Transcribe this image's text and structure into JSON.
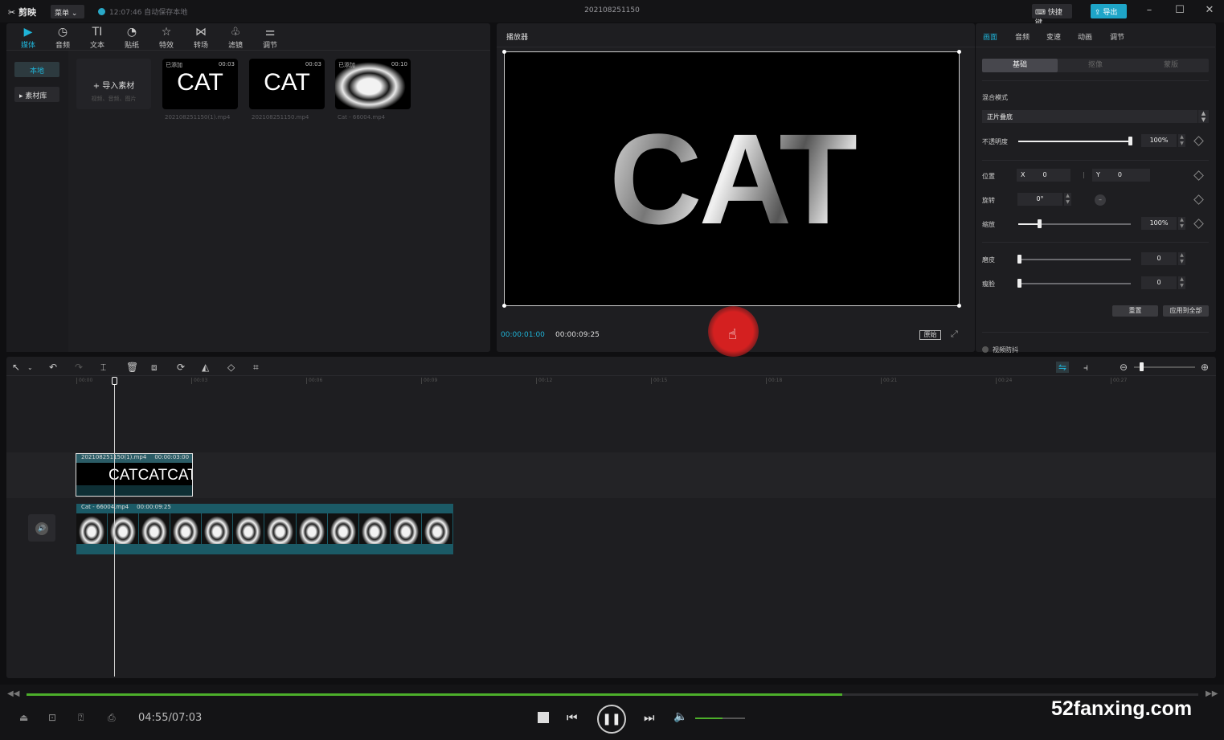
{
  "titlebar": {
    "app_name": "剪映",
    "menu_label": "菜单 ⌄",
    "save_status": "12:07:46 自动保存本地",
    "project_title": "202108251150",
    "shortcut_label": "⌨ 快捷键",
    "export_label": "⇪ 导出"
  },
  "media_toolbar": [
    {
      "icon": "▶",
      "label": "媒体"
    },
    {
      "icon": "◷",
      "label": "音频"
    },
    {
      "icon": "TI",
      "label": "文本"
    },
    {
      "icon": "◔",
      "label": "贴纸"
    },
    {
      "icon": "☆",
      "label": "特效"
    },
    {
      "icon": "⋈",
      "label": "转场"
    },
    {
      "icon": "♧",
      "label": "滤镜"
    },
    {
      "icon": "⚌",
      "label": "调节"
    }
  ],
  "left_nav": {
    "local": "本地",
    "library": "▸ 素材库"
  },
  "import": {
    "label": "+ 导入素材",
    "hint": "视频、音频、图片"
  },
  "media_items": [
    {
      "tag": "已添加",
      "duration": "00:03",
      "text": "CAT",
      "name": "202108251150(1).mp4"
    },
    {
      "tag": "",
      "duration": "00:03",
      "text": "CAT",
      "name": "202108251150.mp4"
    },
    {
      "tag": "已添加",
      "duration": "00:10",
      "text": "",
      "name": "Cat - 66004.mp4"
    }
  ],
  "player": {
    "title": "播放器",
    "big_text": "CAT",
    "current_time": "00:00:01:00",
    "total_time": "00:00:09:25",
    "ratio_label": "原始"
  },
  "properties": {
    "tabs": [
      "画面",
      "音频",
      "变速",
      "动画",
      "调节"
    ],
    "segments": [
      "基础",
      "抠像",
      "蒙版"
    ],
    "blend_label": "混合模式",
    "blend_value": "正片叠底",
    "opacity_label": "不透明度",
    "opacity_value": "100%",
    "opacity_level": 1.0,
    "position_label": "位置",
    "x_label": "X",
    "x_value": "0",
    "y_label": "Y",
    "y_value": "0",
    "rotate_label": "旋转",
    "rotate_value": "0°",
    "scale_label": "缩放",
    "scale_value": "100%",
    "smooth_label": "磨皮",
    "smooth_value": "0",
    "slim_label": "瘦脸",
    "slim_value": "0",
    "reset_label": "重置",
    "apply_all_label": "应用到全部",
    "stabilize_label": "视频防抖"
  },
  "timeline": {
    "ticks": [
      "00:00",
      "00:03",
      "00:06",
      "00:09",
      "00:12",
      "00:15",
      "00:18",
      "00:21",
      "00:24",
      "00:27"
    ],
    "text_clip": {
      "name": "202108251150(1).mp4",
      "duration": "00:00:03:00",
      "content": "CATCATCAT"
    },
    "video_clip": {
      "name": "Cat - 66004.mp4",
      "duration": "00:00:09:25"
    }
  },
  "bottom": {
    "time": "04:55/07:03",
    "progress": 0.696,
    "volume": 0.55
  },
  "watermark": "52fanxing.com",
  "colors": {
    "accent": "#1fb3d7",
    "progress": "#4caf2a",
    "export": "#1ea5c8"
  }
}
